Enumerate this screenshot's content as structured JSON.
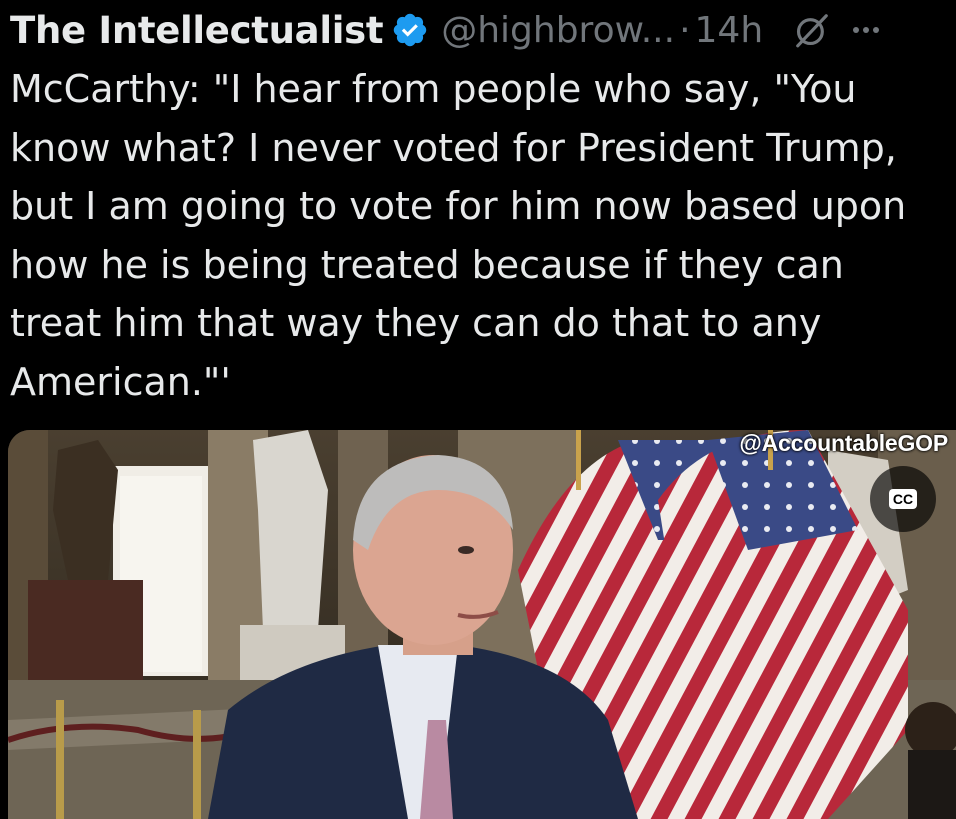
{
  "tweet": {
    "author_name": "The Intellectualist",
    "author_handle": "@highbrow...",
    "separator": "·",
    "time": "14h",
    "text": "McCarthy: \"I hear from people who say, \"You\nknow what? I never voted for President Trump,\nbut I am going to vote for him now based upon\nhow he is being treated because if they can\ntreat him that way they can do that to any\nAmerican.\"'"
  },
  "media": {
    "watermark": "@AccountableGOP",
    "cc_label": "CC"
  },
  "icons": {
    "verified": "verified-badge-icon",
    "grok": "grok-icon",
    "more": "more-options-icon",
    "captions": "closed-captions-icon"
  },
  "colors": {
    "background": "#000000",
    "text": "#e7e9ea",
    "secondary_text": "#71767b",
    "verified_blue": "#1d9bf0"
  }
}
